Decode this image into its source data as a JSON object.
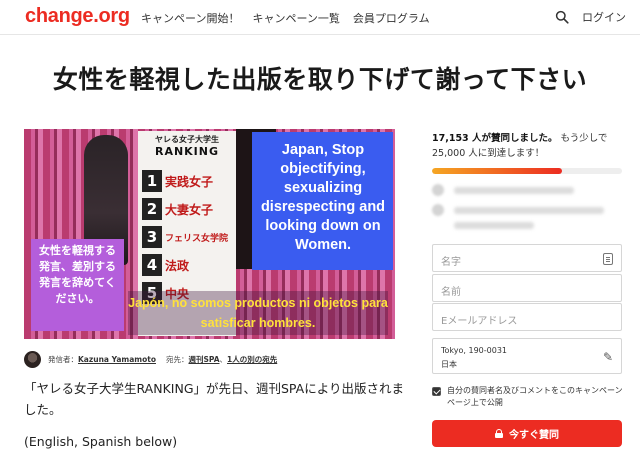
{
  "header": {
    "logo": "change.org",
    "nav": [
      "キャンペーン開始！",
      "キャンペーン一覧",
      "会員プログラム"
    ],
    "search_icon": "search-icon",
    "login": "ログイン"
  },
  "petition": {
    "title": "女性を軽視した出版を取り下げて謝って下さい",
    "image": {
      "ranking_subtitle": "ヤレる女子大学生",
      "ranking_title": "RANKING",
      "ranking_items": [
        {
          "num": "1",
          "label": "実践女子"
        },
        {
          "num": "2",
          "label": "大妻女子"
        },
        {
          "num": "3",
          "label": "フェリス女学院"
        },
        {
          "num": "4",
          "label": "法政"
        },
        {
          "num": "5",
          "label": "中央"
        }
      ],
      "english_text": "Japan, Stop objectifying, sexualizing disrespecting and looking down on Women.",
      "japanese_text": "女性を軽視する発言、差別する発言を辞めてください。",
      "spanish_text": "Japón, no somos productos ni objetos para satisficar hombres."
    },
    "byline": {
      "sender_label": "発信者：",
      "sender_name": "Kazuna Yamamoto",
      "recipient_label": "宛先：",
      "recipient_1": "週刊SPA",
      "recipient_sep": "、",
      "recipient_2": "1人の別の宛先"
    },
    "body_line1": "「ヤレる女子大学生RANKING」が先日、週刊SPAにより出版されました。",
    "body_line2": "(English, Spanish below)"
  },
  "sidebar": {
    "signers_count": "17,153 人が賛同しました。",
    "signers_tail": "もう少しで",
    "goal_text": "25,000 人に到達します！",
    "progress": 0.686,
    "name_placeholder": "名字",
    "firstname_placeholder": "名前",
    "email_placeholder": "Eメールアドレス",
    "location_line1": "Tokyo, 190-0031",
    "location_line2": "日本",
    "consent_text": "自分の賛同者名及びコメントをこのキャンペーンページ上で公開",
    "sign_button": "今すぐ賛同",
    "accent_color": "#ec2c22"
  }
}
